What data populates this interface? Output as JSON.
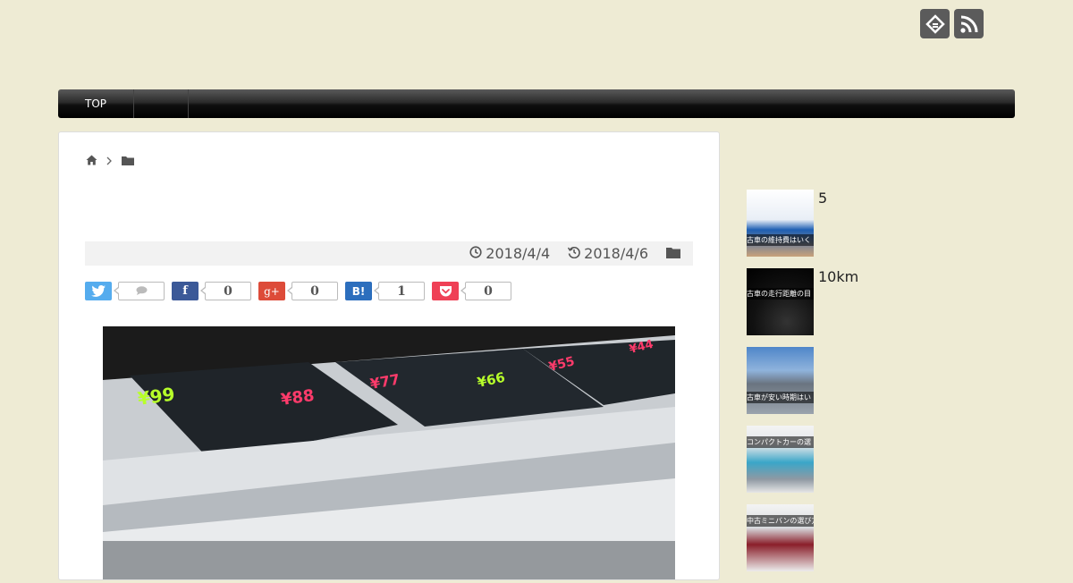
{
  "header": {
    "icons": [
      "feedly-icon",
      "rss-icon"
    ],
    "icon_color": "#5b5b5b"
  },
  "nav": {
    "items": [
      {
        "label": "TOP"
      },
      {
        "label": ""
      }
    ]
  },
  "article": {
    "breadcrumb": {
      "home_icon": "home-icon",
      "category_icon": "folder-icon"
    },
    "meta": {
      "published": "2018/4/4",
      "updated": "2018/4/6"
    },
    "share": {
      "twitter": {
        "label": "",
        "count": "",
        "color": "#55acee"
      },
      "facebook": {
        "label": "f",
        "count": "0",
        "color": "#3b5998"
      },
      "googleplus": {
        "label": "g+",
        "count": "0",
        "color": "#dd4b39"
      },
      "hatena": {
        "label": "B!",
        "count": "1",
        "color": "#2c6ebd"
      },
      "pocket": {
        "label": "",
        "count": "0",
        "color": "#ef4056"
      }
    }
  },
  "sidebar": {
    "items": [
      {
        "text": "5",
        "thumb_caption": "古車の維持費はいく"
      },
      {
        "text": "10km",
        "thumb_caption": "古車の走行距離の目"
      },
      {
        "text": "",
        "thumb_caption": "古車が安い時期はい"
      },
      {
        "text": "",
        "thumb_caption": "コンパクトカーの選"
      },
      {
        "text": "",
        "thumb_caption": "中古ミニバンの選び方"
      }
    ]
  }
}
